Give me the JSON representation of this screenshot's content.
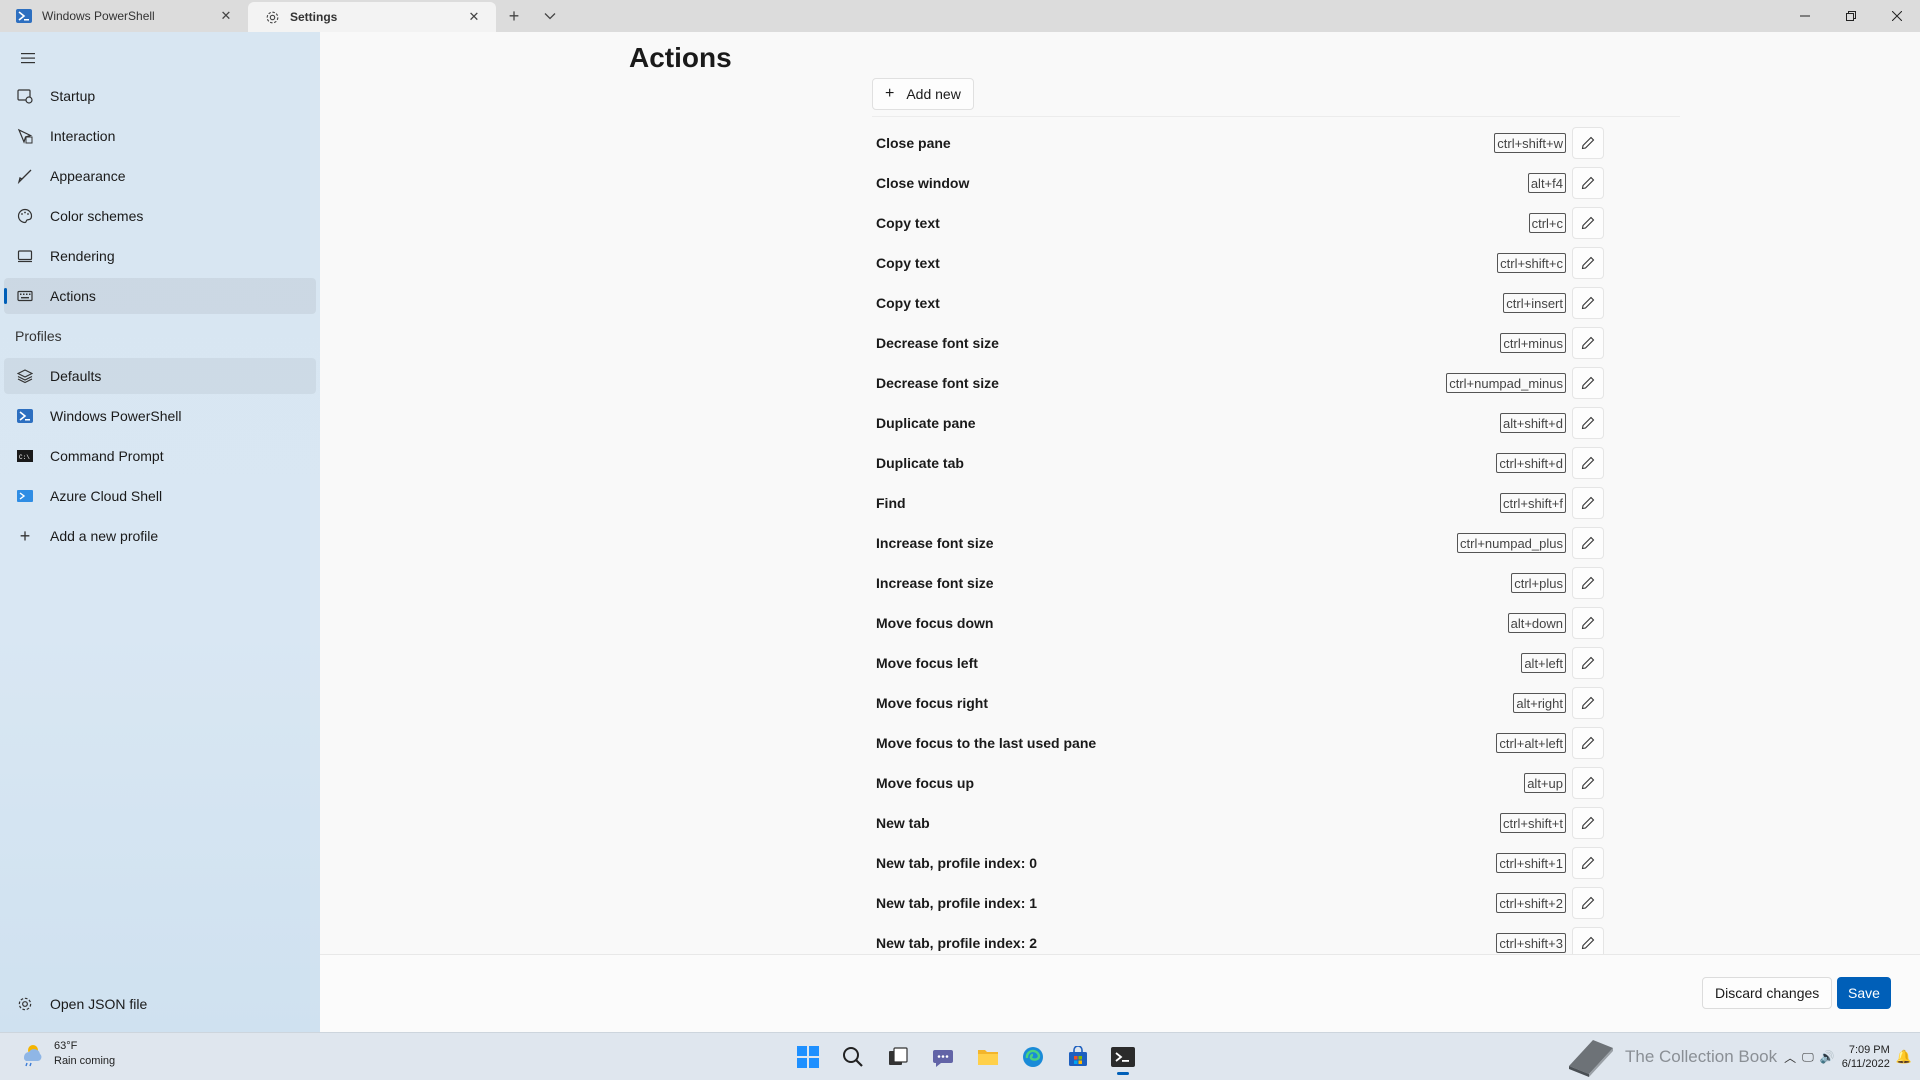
{
  "tabs": [
    {
      "label": "Windows PowerShell",
      "icon": "powershell-icon",
      "active": false
    },
    {
      "label": "Settings",
      "icon": "gear-icon",
      "active": true
    }
  ],
  "sidebar": {
    "items": [
      {
        "label": "Startup",
        "icon": "startup-icon"
      },
      {
        "label": "Interaction",
        "icon": "interaction-icon"
      },
      {
        "label": "Appearance",
        "icon": "paintbrush-icon"
      },
      {
        "label": "Color schemes",
        "icon": "palette-icon"
      },
      {
        "label": "Rendering",
        "icon": "monitor-icon"
      },
      {
        "label": "Actions",
        "icon": "keyboard-icon",
        "selected": true
      }
    ],
    "profiles_header": "Profiles",
    "profiles": [
      {
        "label": "Defaults",
        "icon": "layers-icon"
      },
      {
        "label": "Windows PowerShell",
        "icon": "powershell-icon"
      },
      {
        "label": "Command Prompt",
        "icon": "cmd-icon"
      },
      {
        "label": "Azure Cloud Shell",
        "icon": "azure-icon"
      },
      {
        "label": "Add a new profile",
        "icon": "plus-icon"
      }
    ],
    "open_json": "Open JSON file"
  },
  "main": {
    "title": "Actions",
    "add_new_label": "Add new",
    "actions": [
      {
        "name": "Close pane",
        "keys": "ctrl+shift+w"
      },
      {
        "name": "Close window",
        "keys": "alt+f4"
      },
      {
        "name": "Copy text",
        "keys": "ctrl+c"
      },
      {
        "name": "Copy text",
        "keys": "ctrl+shift+c"
      },
      {
        "name": "Copy text",
        "keys": "ctrl+insert"
      },
      {
        "name": "Decrease font size",
        "keys": "ctrl+minus"
      },
      {
        "name": "Decrease font size",
        "keys": "ctrl+numpad_minus"
      },
      {
        "name": "Duplicate pane",
        "keys": "alt+shift+d"
      },
      {
        "name": "Duplicate tab",
        "keys": "ctrl+shift+d"
      },
      {
        "name": "Find",
        "keys": "ctrl+shift+f"
      },
      {
        "name": "Increase font size",
        "keys": "ctrl+numpad_plus"
      },
      {
        "name": "Increase font size",
        "keys": "ctrl+plus"
      },
      {
        "name": "Move focus down",
        "keys": "alt+down"
      },
      {
        "name": "Move focus left",
        "keys": "alt+left"
      },
      {
        "name": "Move focus right",
        "keys": "alt+right"
      },
      {
        "name": "Move focus to the last used pane",
        "keys": "ctrl+alt+left"
      },
      {
        "name": "Move focus up",
        "keys": "alt+up"
      },
      {
        "name": "New tab",
        "keys": "ctrl+shift+t"
      },
      {
        "name": "New tab, profile index: 0",
        "keys": "ctrl+shift+1"
      },
      {
        "name": "New tab, profile index: 1",
        "keys": "ctrl+shift+2"
      },
      {
        "name": "New tab, profile index: 2",
        "keys": "ctrl+shift+3"
      }
    ]
  },
  "footer": {
    "discard_label": "Discard changes",
    "save_label": "Save"
  },
  "taskbar": {
    "weather_temp": "63°F",
    "weather_desc": "Rain coming",
    "watermark": "The Collection Book",
    "time": "7:09 PM",
    "date": "6/11/2022"
  },
  "colors": {
    "accent": "#005fb8",
    "sidebar_bg": "#d8e6f2"
  }
}
